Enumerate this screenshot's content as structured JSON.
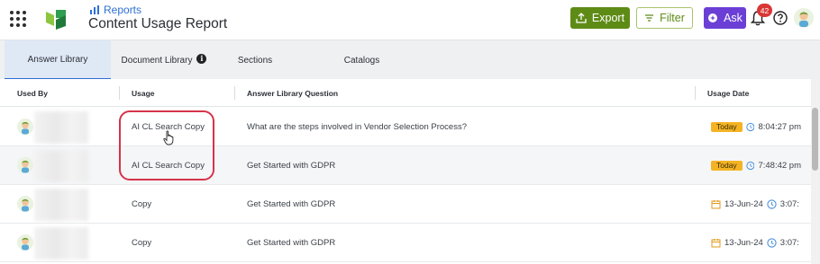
{
  "header": {
    "breadcrumb": "Reports",
    "title": "Content Usage Report",
    "export_label": "Export",
    "filter_label": "Filter",
    "ask_label": "Ask",
    "notification_count": "42"
  },
  "tabs": [
    {
      "label": "Answer Library",
      "active": true
    },
    {
      "label": "Document Library",
      "active": false
    },
    {
      "label": "Sections",
      "active": false
    },
    {
      "label": "Catalogs",
      "active": false
    }
  ],
  "table": {
    "columns": [
      "Used By",
      "Usage",
      "Answer Library Question",
      "Usage Date"
    ],
    "rows": [
      {
        "usage": "AI CL Search Copy",
        "question": "What are the steps involved in Vendor Selection Process?",
        "date_badge": "Today",
        "time": "8:04:27 pm"
      },
      {
        "usage": "AI CL Search Copy",
        "question": "Get Started with GDPR",
        "date_badge": "Today",
        "time": "7:48:42 pm"
      },
      {
        "usage": "Copy",
        "question": "Get Started with GDPR",
        "date": "13-Jun-24",
        "time": "3:07:"
      },
      {
        "usage": "Copy",
        "question": "Get Started with GDPR",
        "date": "13-Jun-24",
        "time": "3:07:"
      }
    ]
  },
  "colors": {
    "export": "#5e8b16",
    "ask": "#6b3fd6",
    "today_badge": "#f4b324",
    "highlight": "#d6334b",
    "active_tab": "#2d6fd6"
  }
}
